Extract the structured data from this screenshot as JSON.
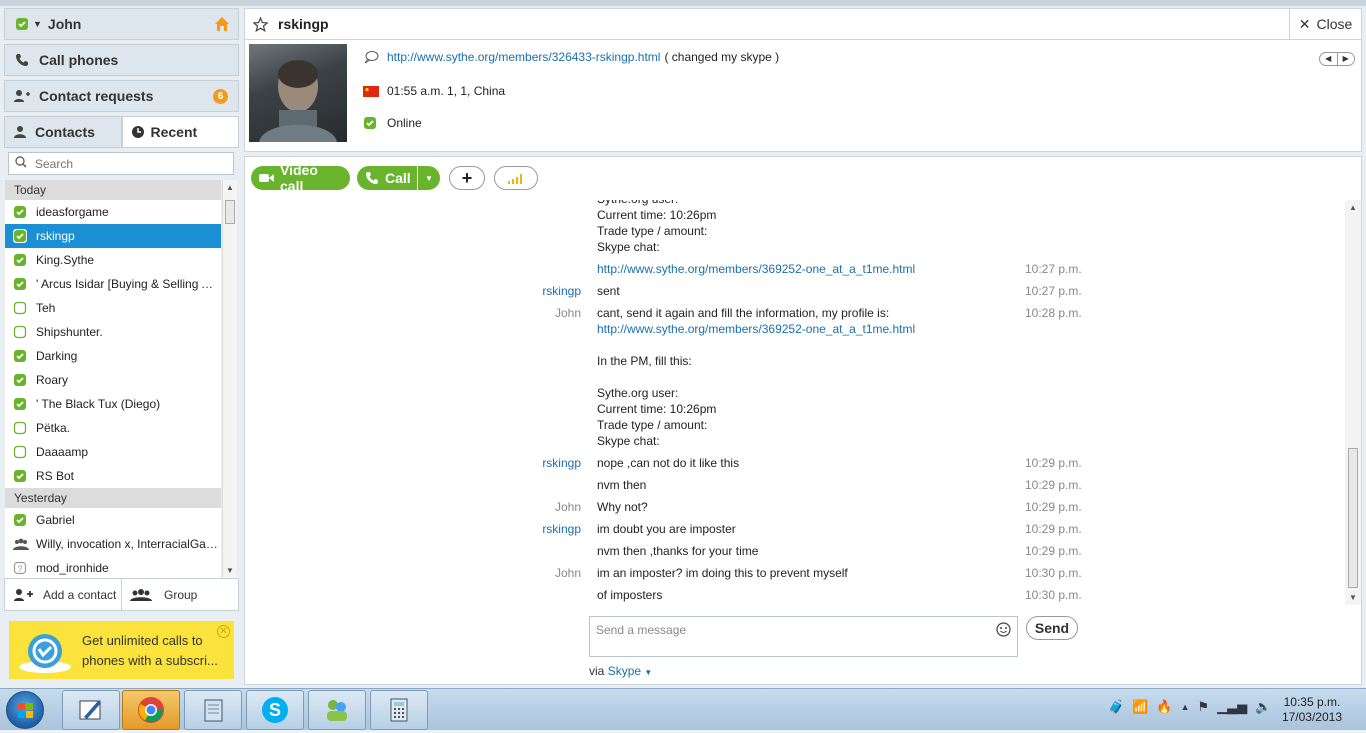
{
  "user": {
    "name": "John"
  },
  "nav": {
    "call_phones": "Call phones",
    "contact_requests": "Contact requests",
    "requests_count": "6"
  },
  "tabs": {
    "contacts": "Contacts",
    "recent": "Recent"
  },
  "search": {
    "placeholder": "Search"
  },
  "groups": {
    "today": "Today",
    "yesterday": "Yesterday"
  },
  "contacts_today": [
    {
      "name": "ideasforgame",
      "status": "online"
    },
    {
      "name": "rskingp",
      "status": "online",
      "selected": true
    },
    {
      "name": "King.Sythe",
      "status": "online"
    },
    {
      "name": "' Arcus Isidar [Buying & Selling All 2...",
      "status": "online"
    },
    {
      "name": "Teh",
      "status": "offline"
    },
    {
      "name": "Shipshunter.",
      "status": "offline"
    },
    {
      "name": "Darking",
      "status": "online"
    },
    {
      "name": "Roary",
      "status": "online"
    },
    {
      "name": "' The Black Tux (Diego)",
      "status": "online"
    },
    {
      "name": "Pёtka.",
      "status": "offline"
    },
    {
      "name": "Daaaamp",
      "status": "offline"
    },
    {
      "name": "RS Bot",
      "status": "online"
    }
  ],
  "contacts_yesterday": [
    {
      "name": "Gabriel",
      "status": "online"
    },
    {
      "name": "Willy, invocation x, InterracialGame...",
      "status": "group"
    },
    {
      "name": "mod_ironhide",
      "status": "unknown"
    }
  ],
  "bottom": {
    "add_contact": "Add a contact",
    "group": "Group"
  },
  "promo": {
    "text": "Get unlimited calls to phones with a subscri..."
  },
  "header": {
    "contact_name": "rskingp",
    "close": "Close"
  },
  "profile": {
    "mood_link": "http://www.sythe.org/members/326433-rskingp.html",
    "mood_suffix": "( changed my skype )",
    "local_time": "01:55 a.m. 1, 1, China",
    "status": "Online"
  },
  "toolbar": {
    "video_call": "Video call",
    "call": "Call"
  },
  "messages": [
    {
      "sender": "",
      "text": "Sythe.org user:",
      "time": ""
    },
    {
      "sender": "",
      "text": "Current time: 10:26pm",
      "time": ""
    },
    {
      "sender": "",
      "text": "Trade type / amount:",
      "time": ""
    },
    {
      "sender": "",
      "text": "Skype chat:",
      "time": ""
    },
    {
      "sender": "",
      "text": "http://www.sythe.org/members/369252-one_at_a_t1me.html",
      "time": "10:27 p.m.",
      "link": true
    },
    {
      "sender": "rskingp",
      "text": "sent",
      "time": "10:27 p.m."
    },
    {
      "sender": "John",
      "text": "cant, send it again and fill the information, my profile is:",
      "time": "10:28 p.m."
    },
    {
      "sender": "",
      "text": "http://www.sythe.org/members/369252-one_at_a_t1me.html",
      "time": "",
      "link": true
    },
    {
      "sender": "",
      "text": "In the PM, fill this:",
      "time": ""
    },
    {
      "sender": "",
      "text": "Sythe.org user:",
      "time": ""
    },
    {
      "sender": "",
      "text": "Current time: 10:26pm",
      "time": ""
    },
    {
      "sender": "",
      "text": "Trade type / amount:",
      "time": ""
    },
    {
      "sender": "",
      "text": "Skype chat:",
      "time": ""
    },
    {
      "sender": "rskingp",
      "text": "nope ,can not do it like this",
      "time": "10:29 p.m."
    },
    {
      "sender": "",
      "text": "nvm then",
      "time": "10:29 p.m."
    },
    {
      "sender": "John",
      "text": "Why not?",
      "time": "10:29 p.m."
    },
    {
      "sender": "rskingp",
      "text": "im doubt you are imposter",
      "time": "10:29 p.m."
    },
    {
      "sender": "",
      "text": "nvm then ,thanks for your time",
      "time": "10:29 p.m."
    },
    {
      "sender": "John",
      "text": "im an imposter? im doing this to prevent myself",
      "time": "10:30 p.m."
    },
    {
      "sender": "",
      "text": "of imposters",
      "time": "10:30 p.m."
    }
  ],
  "compose": {
    "placeholder": "Send a message",
    "send": "Send",
    "via": "via",
    "via_service": "Skype"
  },
  "clock": {
    "time": "10:35 p.m.",
    "date": "17/03/2013"
  },
  "colors": {
    "accent": "#1a8fd4",
    "green": "#6ab42d",
    "promo": "#fce33c",
    "badge": "#f39a1c"
  }
}
